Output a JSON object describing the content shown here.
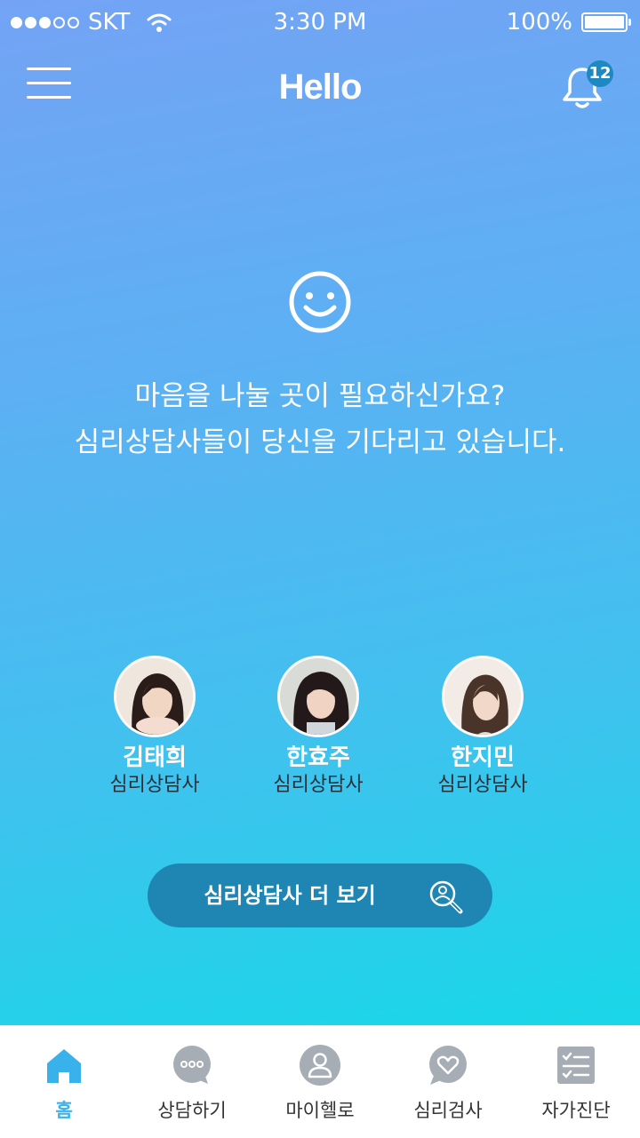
{
  "status": {
    "carrier": "SKT",
    "time": "3:30 PM",
    "battery": "100%"
  },
  "header": {
    "title": "Hello",
    "notification_count": "12"
  },
  "message": {
    "line1": "마음을 나눌 곳이 필요하신가요?",
    "line2": "심리상담사들이 당신을 기다리고 있습니다."
  },
  "counselors": [
    {
      "name": "김태희",
      "role": "심리상담사"
    },
    {
      "name": "한효주",
      "role": "심리상담사"
    },
    {
      "name": "한지민",
      "role": "심리상담사"
    }
  ],
  "more_button": {
    "label": "심리상담사 더 보기"
  },
  "tabs": [
    {
      "label": "홈",
      "icon": "home-icon",
      "active": true
    },
    {
      "label": "상담하기",
      "icon": "chat-bubble-icon",
      "active": false
    },
    {
      "label": "마이헬로",
      "icon": "user-icon",
      "active": false
    },
    {
      "label": "심리검사",
      "icon": "heart-bubble-icon",
      "active": false
    },
    {
      "label": "자가진단",
      "icon": "checklist-icon",
      "active": false
    }
  ],
  "colors": {
    "accent": "#39b2ec",
    "button": "#1f86b3",
    "badge": "#1e88c2",
    "tab_icon_inactive": "#a6adb4"
  }
}
